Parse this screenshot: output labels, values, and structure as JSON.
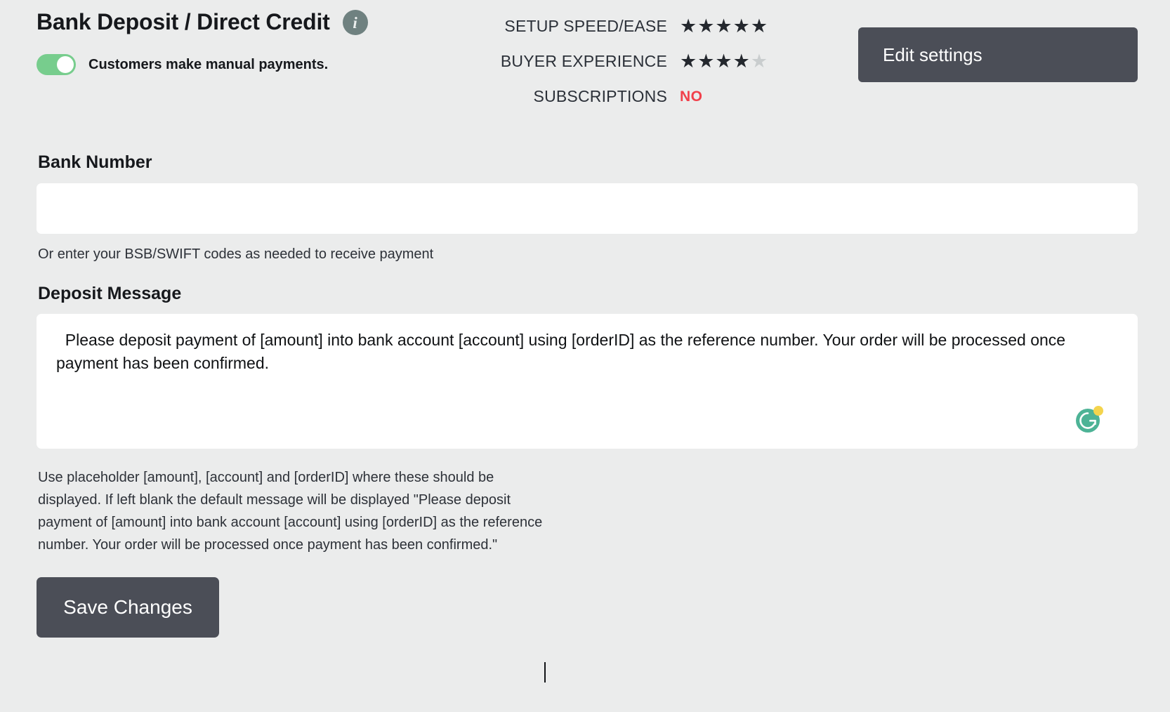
{
  "header": {
    "title": "Bank Deposit / Direct Credit",
    "info_icon": "info-icon",
    "toggle_label": "Customers make manual payments.",
    "toggle_state": "on",
    "toggle_color": "#77cd8d"
  },
  "ratings": [
    {
      "label": "SETUP SPEED/EASE",
      "type": "stars",
      "filled": 5,
      "total": 5,
      "value": "★★★★★"
    },
    {
      "label": "BUYER EXPERIENCE",
      "type": "stars",
      "filled": 4,
      "total": 5,
      "value": "★★★★",
      "value_off": "★"
    },
    {
      "label": "SUBSCRIPTIONS",
      "type": "text",
      "value": "NO",
      "color": "#f1404b"
    }
  ],
  "actions": {
    "edit_settings_label": "Edit settings",
    "save_changes_label": "Save Changes",
    "button_color": "#4b4e57"
  },
  "fields": {
    "bank_number": {
      "label": "Bank Number",
      "value": "",
      "placeholder": "",
      "helper": "Or enter your BSB/SWIFT codes as needed to receive payment"
    },
    "deposit_message": {
      "label": "Deposit Message",
      "value": "  Please deposit payment of [amount] into bank account [account] using [orderID] as the reference number. Your order will be processed once payment has been confirmed.",
      "placeholder": "",
      "helper": "Use placeholder [amount], [account] and [orderID] where these should be displayed. If left blank the default message will be displayed \"Please deposit payment of [amount] into bank account [account] using [orderID] as the reference number. Your order will be processed once payment has been confirmed.\"",
      "assistant_icon": "grammarly-icon"
    }
  },
  "colors": {
    "background": "#ebecec",
    "surface": "#ffffff",
    "accent_green": "#4db396",
    "accent_yellow": "#f4d44d"
  }
}
